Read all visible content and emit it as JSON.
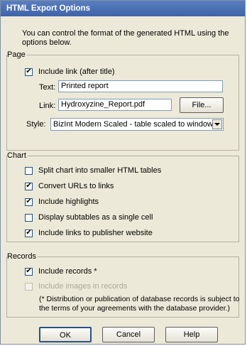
{
  "window": {
    "title": "HTML Export Options"
  },
  "intro_text": "You can control the format of the generated HTML using the options below.",
  "page_group": {
    "label": "Page",
    "include_link": {
      "label": "Include link (after title)",
      "checked": true
    },
    "text_label": "Text:",
    "text_value": "Printed report",
    "link_label": "Link:",
    "link_value": "Hydroxyzine_Report.pdf",
    "file_button": "File...",
    "style_label": "Style:",
    "style_value": "BizInt Modern Scaled - table scaled to window"
  },
  "chart_group": {
    "label": "Chart",
    "options": [
      {
        "label": "Split chart into smaller HTML tables",
        "checked": false
      },
      {
        "label": "Convert URLs to links",
        "checked": true
      },
      {
        "label": "Include highlights",
        "checked": true
      },
      {
        "label": "Display subtables as a single cell",
        "checked": false
      },
      {
        "label": "Include links to publisher website",
        "checked": true
      }
    ]
  },
  "records_group": {
    "label": "Records",
    "include_records": {
      "label": "Include records *",
      "checked": true
    },
    "include_images": {
      "label": "Include images in records",
      "checked": false,
      "disabled": true
    },
    "note": "(* Distribution or publication of database records is subject to the terms of your agreements with the database provider.)"
  },
  "buttons": {
    "ok": "OK",
    "cancel": "Cancel",
    "help": "Help"
  }
}
